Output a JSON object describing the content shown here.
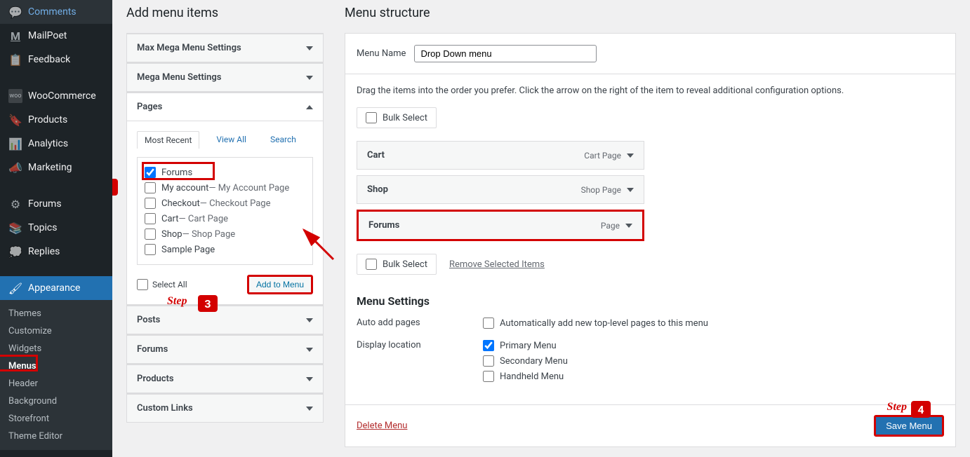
{
  "sidebar": {
    "items": [
      {
        "label": "Comments",
        "icon": "💬"
      },
      {
        "label": "MailPoet",
        "icon": "M"
      },
      {
        "label": "Feedback",
        "icon": "📋"
      },
      {
        "label": "WooCommerce",
        "icon": "woo"
      },
      {
        "label": "Products",
        "icon": "📦"
      },
      {
        "label": "Analytics",
        "icon": "📊"
      },
      {
        "label": "Marketing",
        "icon": "📢"
      },
      {
        "label": "Forums",
        "icon": "⚙"
      },
      {
        "label": "Topics",
        "icon": "📑"
      },
      {
        "label": "Replies",
        "icon": "💭"
      },
      {
        "label": "Appearance",
        "icon": "🖌",
        "active": true
      }
    ],
    "submenu": [
      {
        "label": "Themes"
      },
      {
        "label": "Customize"
      },
      {
        "label": "Widgets"
      },
      {
        "label": "Menus",
        "active": true
      },
      {
        "label": "Header"
      },
      {
        "label": "Background"
      },
      {
        "label": "Storefront"
      },
      {
        "label": "Theme Editor"
      }
    ]
  },
  "left": {
    "title": "Add menu items",
    "accordion": {
      "max_mega": "Max Mega Menu Settings",
      "mega": "Mega Menu Settings",
      "pages": "Pages",
      "posts": "Posts",
      "forums": "Forums",
      "products": "Products",
      "custom_links": "Custom Links"
    },
    "tabs": {
      "recent": "Most Recent",
      "view_all": "View All",
      "search": "Search"
    },
    "pages": [
      {
        "label": "Forums",
        "checked": true
      },
      {
        "label": "My account",
        "suffix": " — My Account Page"
      },
      {
        "label": "Checkout",
        "suffix": " — Checkout Page"
      },
      {
        "label": "Cart",
        "suffix": " — Cart Page"
      },
      {
        "label": "Shop",
        "suffix": " — Shop Page"
      },
      {
        "label": "Sample Page"
      }
    ],
    "select_all": "Select All",
    "add_to_menu": "Add to Menu"
  },
  "right": {
    "title": "Menu structure",
    "menu_name_label": "Menu Name",
    "menu_name_value": "Drop Down menu",
    "instructions": "Drag the items into the order you prefer. Click the arrow on the right of the item to reveal additional configuration options.",
    "bulk_select": "Bulk Select",
    "menu_items": [
      {
        "title": "Cart",
        "type": "Cart Page"
      },
      {
        "title": "Shop",
        "type": "Shop Page"
      },
      {
        "title": "Forums",
        "type": "Page",
        "highlight": true
      }
    ],
    "remove_selected": "Remove Selected Items",
    "settings_title": "Menu Settings",
    "auto_add_label": "Auto add pages",
    "auto_add_text": "Automatically add new top-level pages to this menu",
    "display_location_label": "Display location",
    "locations": [
      {
        "label": "Primary Menu",
        "checked": true
      },
      {
        "label": "Secondary Menu"
      },
      {
        "label": "Handheld Menu"
      }
    ],
    "delete_menu": "Delete Menu",
    "save_menu": "Save Menu"
  },
  "annotations": {
    "step_label": "Step"
  }
}
